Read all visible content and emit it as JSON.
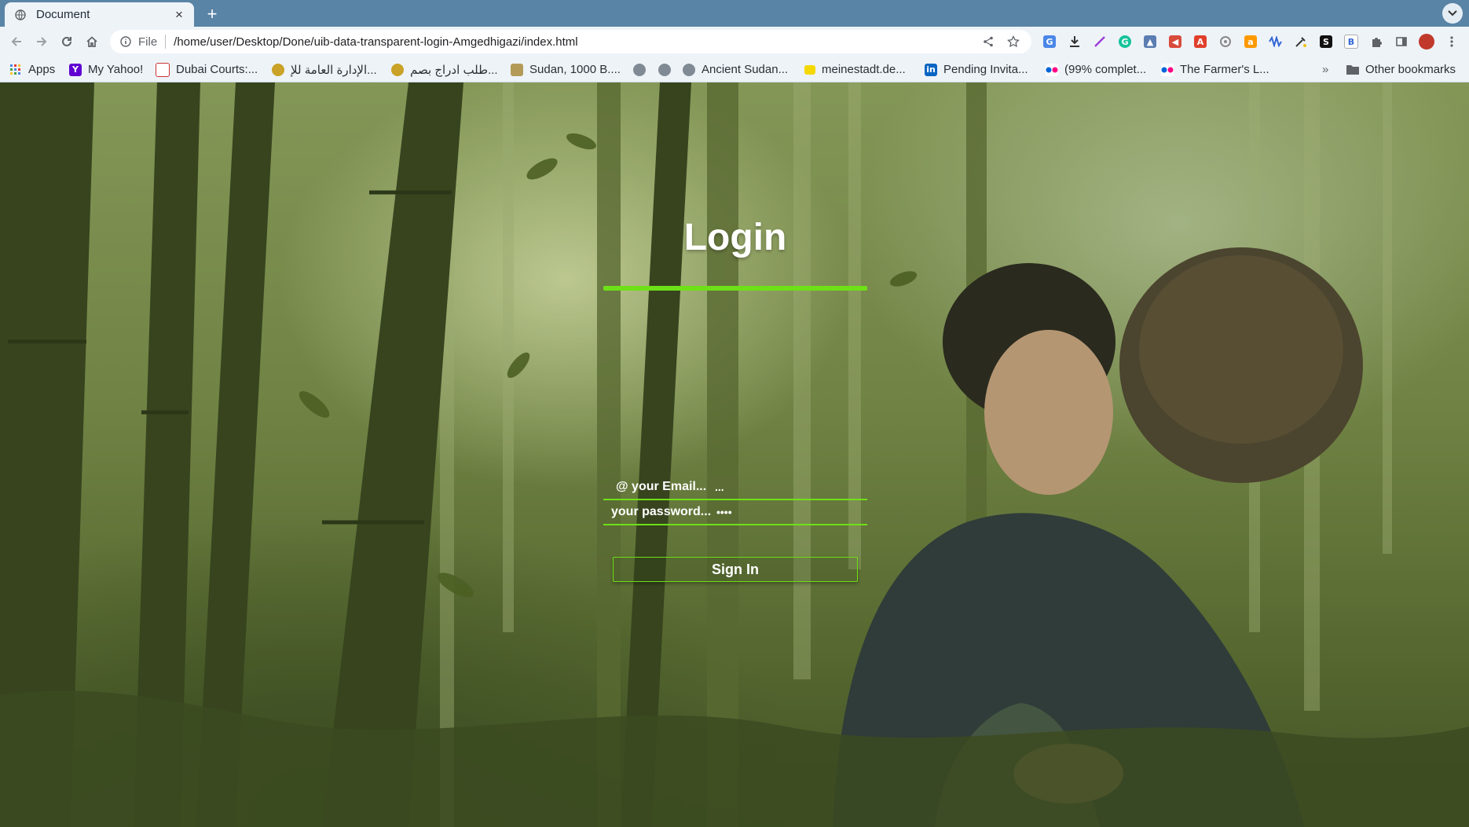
{
  "browser": {
    "tab": {
      "title": "Document",
      "close_glyph": "×"
    },
    "newtab_glyph": "+",
    "address": {
      "scheme_label": "File",
      "url": "/home/user/Desktop/Done/uib-data-transparent-login-Amgedhigazi/index.html"
    },
    "bookmarks": [
      {
        "label": "Apps",
        "icon": "apps-grid-icon"
      },
      {
        "label": "My Yahoo!",
        "icon": "yahoo-icon"
      },
      {
        "label": "Dubai Courts:...",
        "icon": "dubai-courts-icon"
      },
      {
        "label": "الإدارة العامة للإ...",
        "icon": "emblem-icon"
      },
      {
        "label": "طلب ادراج بصم...",
        "icon": "emblem-icon"
      },
      {
        "label": "Sudan, 1000 B....",
        "icon": "folder-image-icon"
      },
      {
        "label": "",
        "icon": "globe-icon"
      },
      {
        "label": "",
        "icon": "globe-icon"
      },
      {
        "label": "Ancient Sudan...",
        "icon": "globe-icon"
      },
      {
        "label": "meinestadt.de...",
        "icon": "meinestadt-icon"
      },
      {
        "label": "Pending Invita...",
        "icon": "linkedin-icon"
      },
      {
        "label": "(99% complet...",
        "icon": "flickr-icon"
      },
      {
        "label": "The Farmer's L...",
        "icon": "flickr-icon"
      }
    ],
    "bookmarks_overflow": "»",
    "other_bookmarks": "Other bookmarks",
    "extensions": [
      "translate",
      "download",
      "pen",
      "grammarly",
      "thumb",
      "megaphone",
      "acrobat",
      "circle",
      "amazon",
      "wave",
      "eyedropper",
      "S",
      "B",
      "puzzle",
      "sidepanel",
      "profile"
    ],
    "colors": {
      "tabstrip": "#5a84a6",
      "toolbar": "#eef3f8"
    }
  },
  "page": {
    "title": "Login",
    "email_placeholder": "@ your Email...",
    "email_autofill": "...",
    "password_placeholder": "your password...",
    "password_autofill": "••••",
    "signin_label": "Sign In",
    "colors": {
      "accent": "#6ee018",
      "text": "#ffffff"
    }
  }
}
